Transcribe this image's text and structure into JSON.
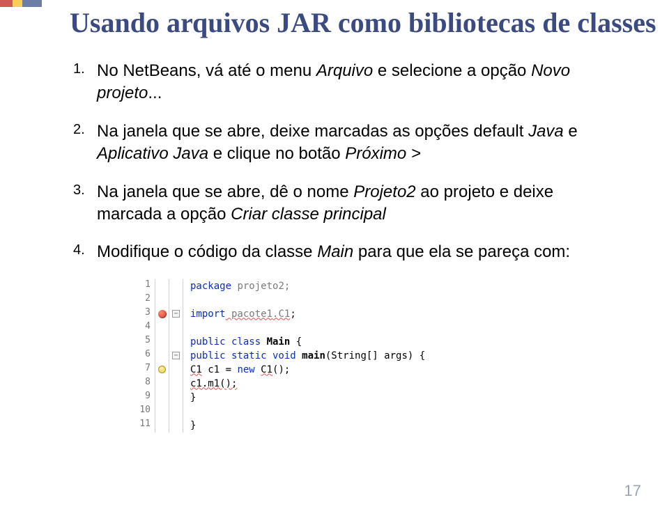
{
  "title": "Usando arquivos JAR como bibliotecas de classes",
  "steps": {
    "s1": {
      "pre": "No NetBeans, vá até o menu ",
      "ital": "Arquivo",
      "mid": " e selecione a opção ",
      "ital2": "Novo projeto",
      "post": "..."
    },
    "s2": {
      "pre": "Na janela que se abre, deixe marcadas as opções default ",
      "ital": "Java",
      "mid": " e ",
      "ital2": "Aplicativo Java",
      "mid2": " e clique no botão ",
      "ital3": "Próximo >"
    },
    "s3": {
      "pre": "Na janela que se abre, dê o nome ",
      "ital": "Projeto2",
      "mid": " ao projeto e deixe marcada a opção ",
      "ital2": "Criar classe principal"
    },
    "s4": {
      "pre": "Modifique o código da classe ",
      "ital": "Main",
      "post": " para que ela se pareça com:"
    }
  },
  "code": {
    "l1_kw": "package",
    "l1_rest": " projeto2;",
    "l3_kw": "import",
    "l3_pkg": " pacote1",
    "l3_cls": ".C1",
    "l3_end": ";",
    "l5_kw": "public class ",
    "l5_name": "Main",
    "l5_brace": " {",
    "l6_kw1": "public static void ",
    "l6_name": "main",
    "l6_sig": "(String[] args) {",
    "l7_a": "C1",
    "l7_b": " c1 = ",
    "l7_kw": "new",
    "l7_c": " ",
    "l7_d": "C1",
    "l7_e": "();",
    "l8": "c1.m1();",
    "l9": "}",
    "l10": "",
    "l11": "}"
  },
  "linenums": {
    "n1": "1",
    "n2": "2",
    "n3": "3",
    "n4": "4",
    "n5": "5",
    "n6": "6",
    "n7": "7",
    "n8": "8",
    "n9": "9",
    "n10": "10",
    "n11": "11"
  },
  "foldmark": "−",
  "pagenum": "17"
}
